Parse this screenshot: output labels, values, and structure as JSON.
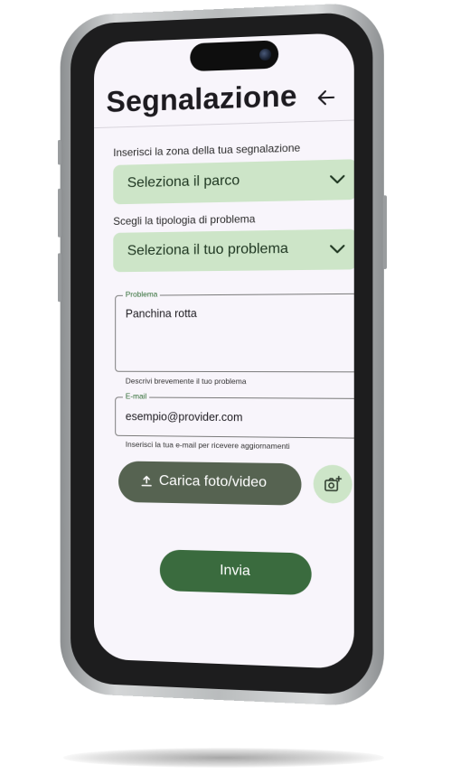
{
  "header": {
    "title": "Segnalazione",
    "back_icon": "arrow-left-icon"
  },
  "zone": {
    "label": "Inserisci la zona della tua segnalazione",
    "selected": "Seleziona il parco"
  },
  "problem_type": {
    "label": "Scegli la tipologia di problema",
    "selected": "Seleziona il tuo problema"
  },
  "problem_field": {
    "legend": "Problema",
    "value": "Panchina rotta",
    "helper": "Descrivi brevemente il tuo problema"
  },
  "email_field": {
    "legend": "E-mail",
    "value": "esempio@provider.com",
    "helper": "Inserisci la tua e-mail per ricevere aggiornamenti"
  },
  "upload_button": {
    "label": "Carica foto/video",
    "icon": "upload-icon"
  },
  "camera_button": {
    "icon": "add-photo-icon"
  },
  "submit_button": {
    "label": "Invia"
  },
  "colors": {
    "primary": "#3a6b3e",
    "tonal": "#566351",
    "container": "#cde5c8",
    "surface": "#f8f5fb"
  }
}
